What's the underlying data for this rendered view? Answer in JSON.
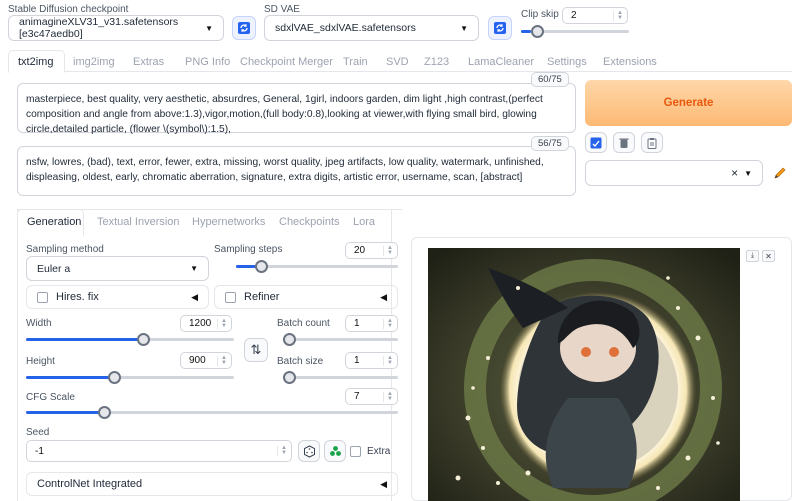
{
  "top": {
    "checkpoint": {
      "label": "Stable Diffusion checkpoint",
      "value": "animagineXLV31_v31.safetensors [e3c47aedb0]"
    },
    "vae": {
      "label": "SD VAE",
      "value": "sdxlVAE_sdxlVAE.safetensors"
    },
    "clip_skip": {
      "label": "Clip skip",
      "value": "2",
      "fraction": 0.09
    }
  },
  "tabs": [
    "txt2img",
    "img2img",
    "Extras",
    "PNG Info",
    "Checkpoint Merger",
    "Train",
    "SVD",
    "Z123",
    "LamaCleaner",
    "Settings",
    "Extensions"
  ],
  "active_tab": "txt2img",
  "prompt": {
    "counter": "60/75",
    "text": "masterpiece, best quality, very aesthetic, absurdres, General, 1girl,  indoors garden, dim light ,high contrast,(perfect composition and angle from above:1.3),vigor,motion,(full body:0.8),looking at viewer,with flying small bird, glowing circle,detailed particle, (flower \\(symbol\\):1.5),"
  },
  "negative": {
    "counter": "56/75",
    "text": "nsfw, lowres, (bad), text, error, fewer, extra, missing, worst quality, jpeg artifacts, low quality, watermark, unfinished, displeasing, oldest, early, chromatic aberration, signature, extra digits, artistic error, username, scan, [abstract]"
  },
  "generate_label": "Generate",
  "style_select": {
    "clear": "×"
  },
  "subtabs": [
    "Generation",
    "Textual Inversion",
    "Hypernetworks",
    "Checkpoints",
    "Lora"
  ],
  "active_subtab": "Generation",
  "sampling": {
    "method_label": "Sampling method",
    "method_value": "Euler a",
    "steps_label": "Sampling steps",
    "steps_value": "20",
    "steps_fraction": 0.13
  },
  "hires": {
    "label": "Hires. fix"
  },
  "refiner": {
    "label": "Refiner"
  },
  "width": {
    "label": "Width",
    "value": "1200",
    "fraction": 0.57
  },
  "height": {
    "label": "Height",
    "value": "900",
    "fraction": 0.42
  },
  "batch_count": {
    "label": "Batch count",
    "value": "1",
    "fraction": 0.0
  },
  "batch_size": {
    "label": "Batch size",
    "value": "1",
    "fraction": 0.0
  },
  "cfg": {
    "label": "CFG Scale",
    "value": "7",
    "fraction": 0.2
  },
  "seed": {
    "label": "Seed",
    "value": "-1",
    "extra_label": "Extra"
  },
  "controlnet": {
    "label": "ControlNet Integrated"
  },
  "colors": {
    "accent": "#2563eb",
    "generate": "#f97316"
  }
}
